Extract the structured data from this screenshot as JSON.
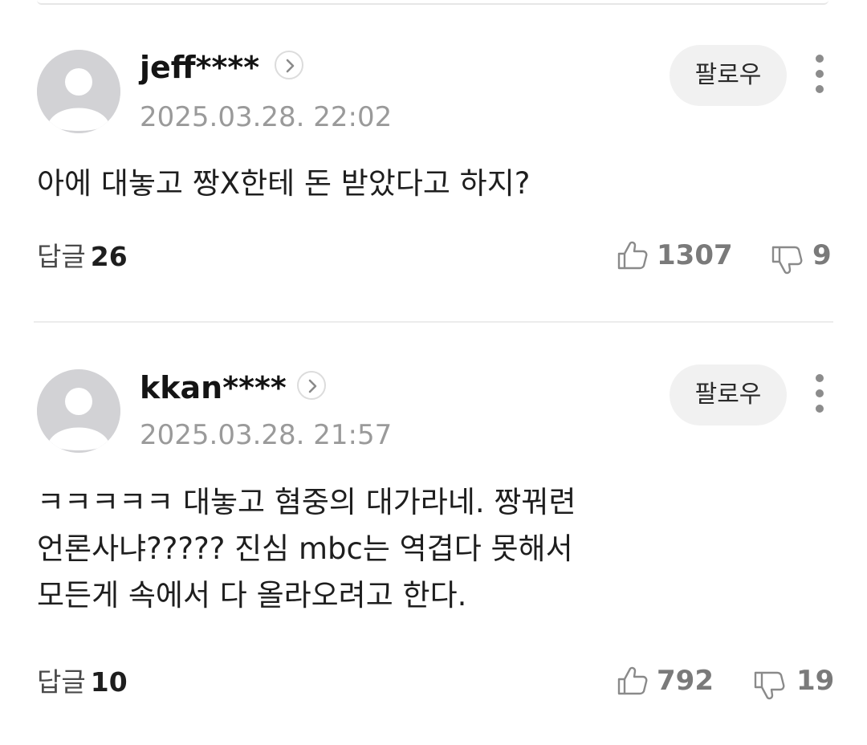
{
  "comments": [
    {
      "username": "jeff****",
      "timestamp": "2025.03.28. 22:02",
      "follow_label": "팔로우",
      "body_lines": [
        "아에 대놓고 짱X한테 돈 받았다고 하지?"
      ],
      "reply_label": "답글",
      "reply_count": "26",
      "likes": "1307",
      "dislikes": "9"
    },
    {
      "username": "kkan****",
      "timestamp": "2025.03.28. 21:57",
      "follow_label": "팔로우",
      "body_lines": [
        "ㅋㅋㅋㅋㅋ 대놓고 혐중의 대가라네. 짱꿔련",
        "언론사냐????? 진심 mbc는 역겹다 못해서",
        "모든게 속에서 다 올라오려고 한다."
      ],
      "reply_label": "답글",
      "reply_count": "10",
      "likes": "792",
      "dislikes": "19"
    }
  ],
  "icons": {
    "avatar": "default-user-avatar-icon",
    "profile_link": "chevron-right-icon",
    "more": "vertical-ellipsis-icon",
    "like": "thumbs-up-icon",
    "dislike": "thumbs-down-icon"
  },
  "colors": {
    "avatar_bg": "#d2d2d5",
    "timestamp": "#9a9a9a",
    "follow_bg": "#f1f1f1",
    "vote_count": "#7a7a7a"
  }
}
